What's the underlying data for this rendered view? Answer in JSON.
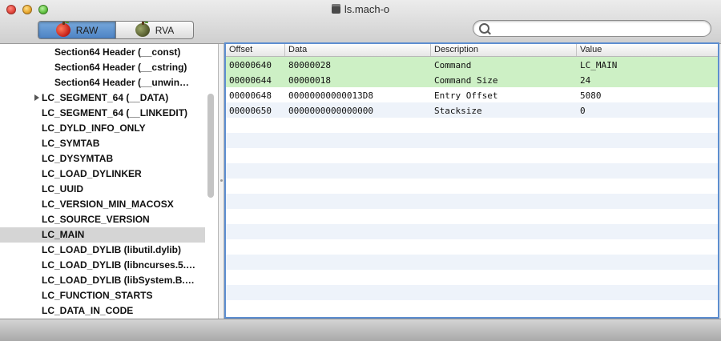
{
  "window": {
    "title": "ls.mach-o"
  },
  "toolbar": {
    "segments": [
      {
        "label": "RAW",
        "icon": "red-apple-icon",
        "active": true
      },
      {
        "label": "RVA",
        "icon": "dark-apple-icon",
        "active": false
      }
    ],
    "search": {
      "value": "",
      "placeholder": ""
    }
  },
  "sidebar": {
    "items": [
      {
        "label": "Section64 Header (__const)",
        "level": 1
      },
      {
        "label": "Section64 Header (__cstring)",
        "level": 1
      },
      {
        "label": "Section64 Header (__unwin…",
        "level": 1
      },
      {
        "label": "LC_SEGMENT_64 (__DATA)",
        "level": 0,
        "expandable": true
      },
      {
        "label": "LC_SEGMENT_64 (__LINKEDIT)",
        "level": 0
      },
      {
        "label": "LC_DYLD_INFO_ONLY",
        "level": 0
      },
      {
        "label": "LC_SYMTAB",
        "level": 0
      },
      {
        "label": "LC_DYSYMTAB",
        "level": 0
      },
      {
        "label": "LC_LOAD_DYLINKER",
        "level": 0
      },
      {
        "label": "LC_UUID",
        "level": 0
      },
      {
        "label": "LC_VERSION_MIN_MACOSX",
        "level": 0
      },
      {
        "label": "LC_SOURCE_VERSION",
        "level": 0
      },
      {
        "label": "LC_MAIN",
        "level": 0,
        "selected": true
      },
      {
        "label": "LC_LOAD_DYLIB (libutil.dylib)",
        "level": 0
      },
      {
        "label": "LC_LOAD_DYLIB (libncurses.5.…",
        "level": 0
      },
      {
        "label": "LC_LOAD_DYLIB (libSystem.B.…",
        "level": 0
      },
      {
        "label": "LC_FUNCTION_STARTS",
        "level": 0
      },
      {
        "label": "LC_DATA_IN_CODE",
        "level": 0
      }
    ]
  },
  "table": {
    "columns": [
      "Offset",
      "Data",
      "Description",
      "Value"
    ],
    "rows": [
      {
        "offset": "00000640",
        "data": "80000028",
        "description": "Command",
        "value": "LC_MAIN",
        "highlight": true
      },
      {
        "offset": "00000644",
        "data": "00000018",
        "description": "Command Size",
        "value": "24",
        "highlight": true
      },
      {
        "offset": "00000648",
        "data": "00000000000013D8",
        "description": "Entry Offset",
        "value": "5080",
        "highlight": false
      },
      {
        "offset": "00000650",
        "data": "0000000000000000",
        "description": "Stacksize",
        "value": "0",
        "highlight": false
      }
    ]
  },
  "colors": {
    "selection_accent": "#5d8ed0",
    "highlight_row": "#cdf0c5",
    "zebra_row": "#eef3fa",
    "sidebar_selected": "#d5d5d5"
  }
}
